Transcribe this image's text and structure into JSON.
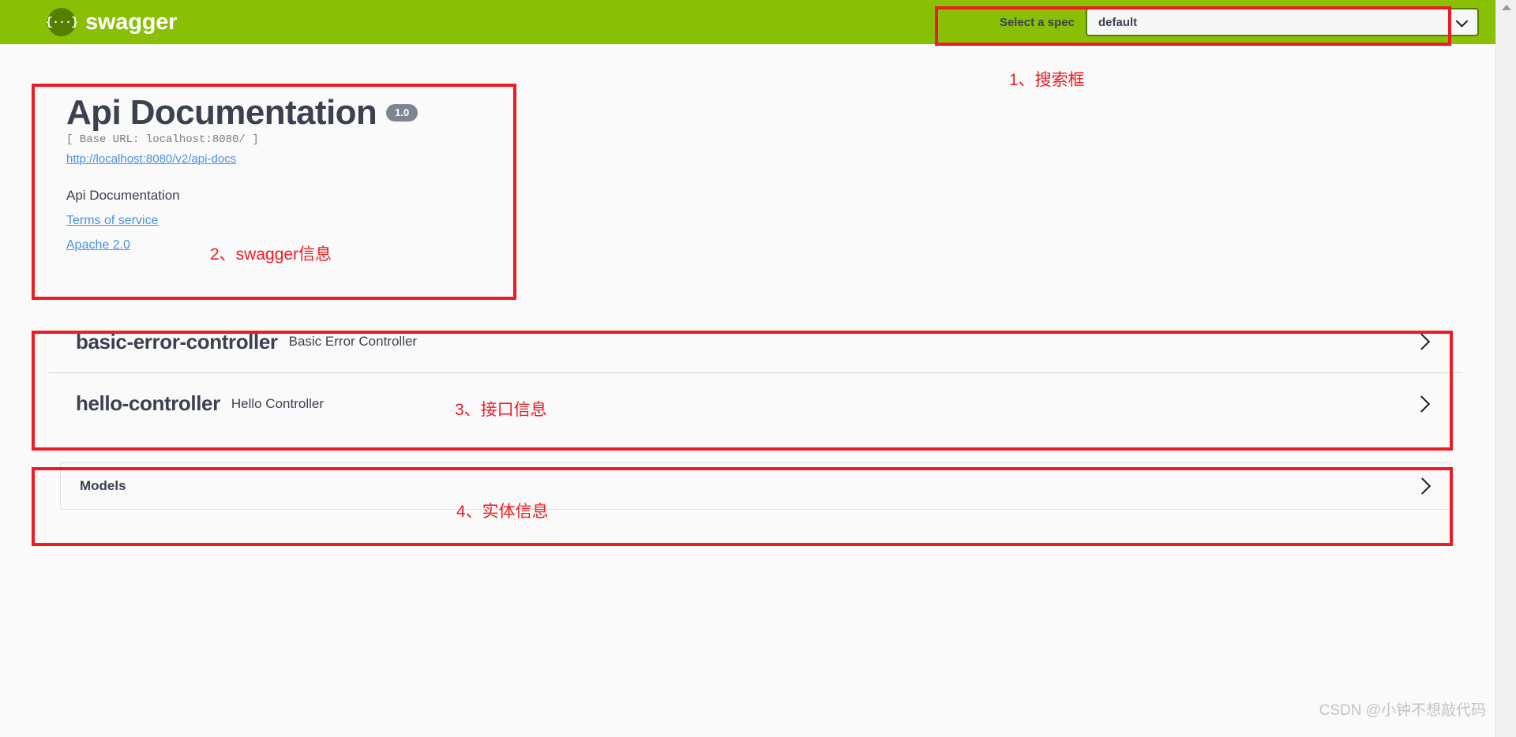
{
  "header": {
    "logo_text": "swagger",
    "logo_icon": "swagger-braces-icon",
    "spec_label": "Select a spec",
    "spec_value": "default",
    "spec_options": [
      "default"
    ],
    "brand_color": "#89bf04",
    "logo_circle_color": "#547f00"
  },
  "info": {
    "title": "Api Documentation",
    "version": "1.0",
    "base_url": "[ Base URL: localhost:8080/ ]",
    "docs_url": "http://localhost:8080/v2/api-docs",
    "description": "Api Documentation",
    "terms_link": "Terms of service",
    "license_link": "Apache 2.0"
  },
  "tags": [
    {
      "name": "basic-error-controller",
      "description": "Basic Error Controller",
      "expand_icon": "chevron-right-icon"
    },
    {
      "name": "hello-controller",
      "description": "Hello Controller",
      "expand_icon": "chevron-right-icon"
    }
  ],
  "models": {
    "title": "Models",
    "expand_icon": "chevron-right-icon"
  },
  "annotations": [
    {
      "id": "a1",
      "text": "1、搜索框"
    },
    {
      "id": "a2",
      "text": "2、swagger信息"
    },
    {
      "id": "a3",
      "text": "3、接口信息"
    },
    {
      "id": "a4",
      "text": "4、实体信息"
    }
  ],
  "annotation_color": "#ed1c24",
  "watermark": "CSDN @小钟不想敲代码"
}
